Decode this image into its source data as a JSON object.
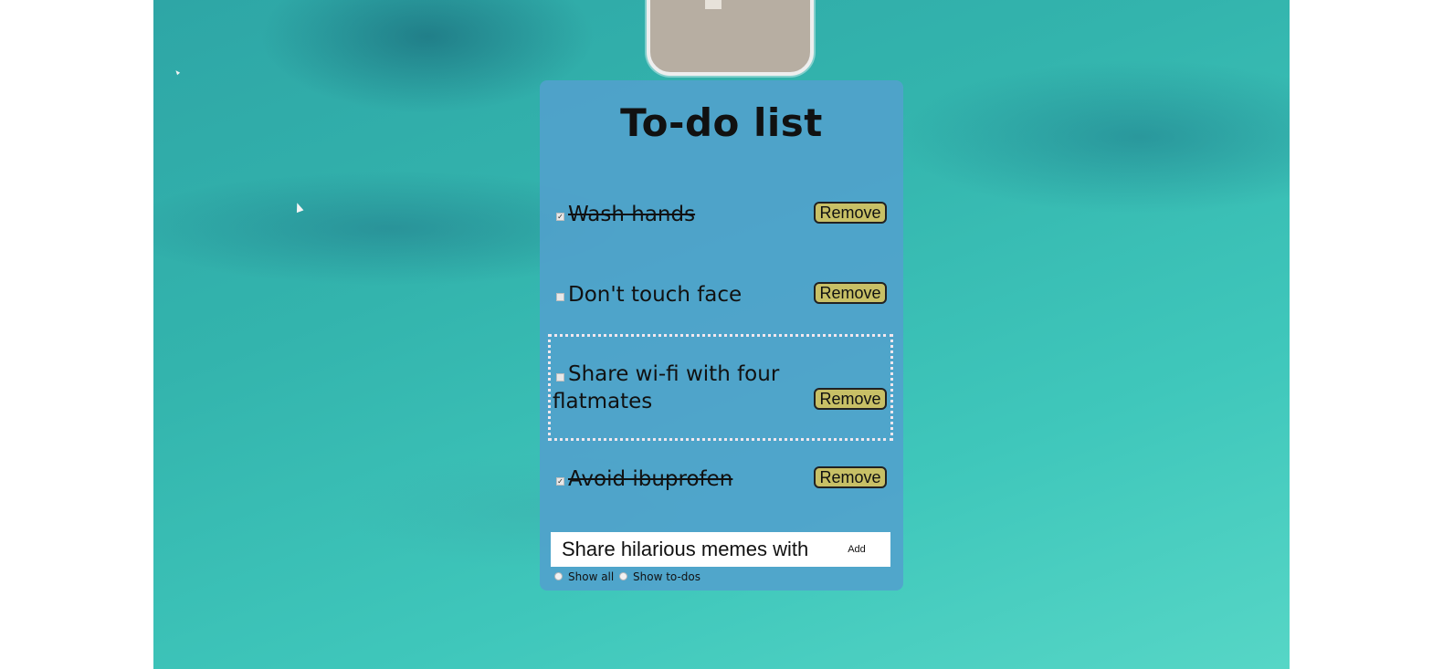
{
  "app": {
    "title": "To-do list"
  },
  "tasks": [
    {
      "label": "Wash hands",
      "done": true,
      "remove_label": "Remove"
    },
    {
      "label": "Don't touch face",
      "done": false,
      "remove_label": "Remove"
    },
    {
      "label": "Share wi-fi with four flatmates",
      "done": false,
      "remove_label": "Remove",
      "focused": true
    },
    {
      "label": "Avoid ibuprofen",
      "done": true,
      "remove_label": "Remove"
    }
  ],
  "add_form": {
    "input_value": "Share hilarious memes with",
    "button_label": "Add"
  },
  "filters": {
    "show_all_label": "Show all",
    "show_todos_label": "Show to-dos",
    "selected": "none"
  },
  "colors": {
    "card_background": "#52a0cd",
    "remove_button": "#c8c066",
    "focus_outline": "#f2e7ee"
  }
}
